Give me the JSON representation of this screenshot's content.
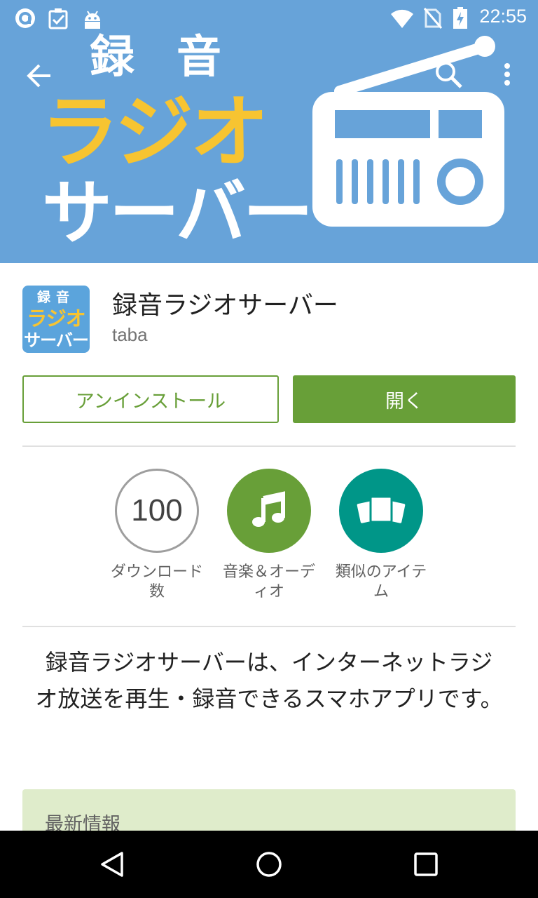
{
  "status_bar": {
    "time": "22:55",
    "icons": [
      "app-notification-icon",
      "clipboard-check-icon",
      "android-icon",
      "wifi-icon",
      "no-sim-icon",
      "battery-charging-icon"
    ]
  },
  "toolbar": {
    "back_icon": "arrow-left-icon",
    "search_icon": "search-icon",
    "menu_icon": "more-vert-icon"
  },
  "hero": {
    "line1": "録音",
    "line2": "ラジオ",
    "line3": "サーバー",
    "colors": {
      "background": "#67a3d9",
      "accent": "#f7c431"
    }
  },
  "app": {
    "icon_text": {
      "line1": "録音",
      "line2": "ラジオ",
      "line3": "サーバー"
    },
    "title": "録音ラジオサーバー",
    "developer": "taba"
  },
  "buttons": {
    "uninstall": "アンインストール",
    "open": "開く",
    "accent_color": "#689f38"
  },
  "badges": [
    {
      "value": "100",
      "label": "ダウンロード数"
    },
    {
      "icon": "music-note-icon",
      "label": "音楽＆オーディオ"
    },
    {
      "icon": "similar-items-icon",
      "label": "類似のアイテム"
    }
  ],
  "description": "録音ラジオサーバーは、インターネットラジオ放送を再生・録音できるスマホアプリです。",
  "whats_new": {
    "title": "最新情報"
  },
  "nav": {
    "back": "back-triangle-icon",
    "home": "home-circle-icon",
    "recents": "recents-square-icon"
  }
}
